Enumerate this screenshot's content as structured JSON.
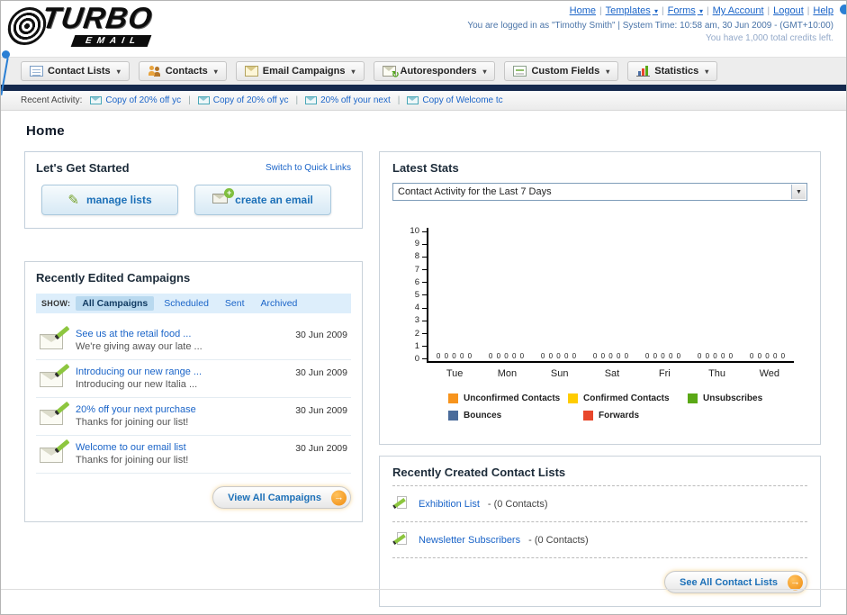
{
  "header": {
    "logo_text": "TURBO",
    "logo_sub": "EMAIL",
    "nav_links": [
      {
        "label": "Home",
        "dropdown": false
      },
      {
        "label": "Templates",
        "dropdown": true
      },
      {
        "label": "Forms",
        "dropdown": true
      },
      {
        "label": "My Account",
        "dropdown": false
      },
      {
        "label": "Logout",
        "dropdown": false
      },
      {
        "label": "Help",
        "dropdown": false
      }
    ],
    "login_info": "You are logged in as \"Timothy Smith\" | System Time: 10:58 am, 30 Jun 2009 - (GMT+10:00)",
    "credits_info": "You have 1,000 total credits left."
  },
  "nav_tabs": [
    {
      "label": "Contact Lists",
      "icon": "contact-lists-icon"
    },
    {
      "label": "Contacts",
      "icon": "contacts-icon"
    },
    {
      "label": "Email Campaigns",
      "icon": "email-campaigns-icon"
    },
    {
      "label": "Autoresponders",
      "icon": "autoresponders-icon"
    },
    {
      "label": "Custom Fields",
      "icon": "custom-fields-icon"
    },
    {
      "label": "Statistics",
      "icon": "statistics-icon"
    }
  ],
  "recent_activity": {
    "label": "Recent Activity:",
    "items": [
      "Copy of 20% off yc",
      "Copy of 20% off yc",
      "20% off your next",
      "Copy of Welcome tc"
    ]
  },
  "page_title": "Home",
  "get_started": {
    "title": "Let's Get Started",
    "switch_link": "Switch to Quick Links",
    "buttons": [
      {
        "label": "manage lists"
      },
      {
        "label": "create an email"
      }
    ]
  },
  "campaigns": {
    "title": "Recently Edited Campaigns",
    "show_label": "SHOW:",
    "tabs": [
      "All Campaigns",
      "Scheduled",
      "Sent",
      "Archived"
    ],
    "active_tab": "All Campaigns",
    "items": [
      {
        "title": "See us at the retail food ...",
        "subtitle": "We're giving away our late ...",
        "date": "30 Jun 2009"
      },
      {
        "title": "Introducing our new range ...",
        "subtitle": "Introducing our new Italia ...",
        "date": "30 Jun 2009"
      },
      {
        "title": "20% off your next purchase",
        "subtitle": "Thanks for joining our list!",
        "date": "30 Jun 2009"
      },
      {
        "title": "Welcome to our email list",
        "subtitle": "Thanks for joining our list!",
        "date": "30 Jun 2009"
      }
    ],
    "view_all_label": "View All Campaigns"
  },
  "stats": {
    "title": "Latest Stats",
    "dropdown_value": "Contact Activity for the Last 7 Days"
  },
  "chart_data": {
    "type": "bar",
    "title": "Contact Activity for the Last 7 Days",
    "categories": [
      "Tue",
      "Mon",
      "Sun",
      "Sat",
      "Fri",
      "Thu",
      "Wed"
    ],
    "series": [
      {
        "name": "Unconfirmed Contacts",
        "color": "#f7941d",
        "values": [
          0,
          0,
          0,
          0,
          0,
          0,
          0
        ]
      },
      {
        "name": "Confirmed Contacts",
        "color": "#ffcc00",
        "values": [
          0,
          0,
          0,
          0,
          0,
          0,
          0
        ]
      },
      {
        "name": "Unsubscribes",
        "color": "#5aa816",
        "values": [
          0,
          0,
          0,
          0,
          0,
          0,
          0
        ]
      },
      {
        "name": "Bounces",
        "color": "#4a6c9b",
        "values": [
          0,
          0,
          0,
          0,
          0,
          0,
          0
        ]
      },
      {
        "name": "Forwards",
        "color": "#e8472b",
        "values": [
          0,
          0,
          0,
          0,
          0,
          0,
          0
        ]
      }
    ],
    "ylim": [
      0,
      10
    ],
    "yticks": [
      0,
      1,
      2,
      3,
      4,
      5,
      6,
      7,
      8,
      9,
      10
    ],
    "grid": false,
    "legend_position": "bottom"
  },
  "contact_lists": {
    "title": "Recently Created Contact Lists",
    "items": [
      {
        "name": "Exhibition List",
        "suffix": " - (0 Contacts)"
      },
      {
        "name": "Newsletter Subscribers",
        "suffix": " - (0 Contacts)"
      }
    ],
    "see_all_label": "See All Contact Lists"
  }
}
